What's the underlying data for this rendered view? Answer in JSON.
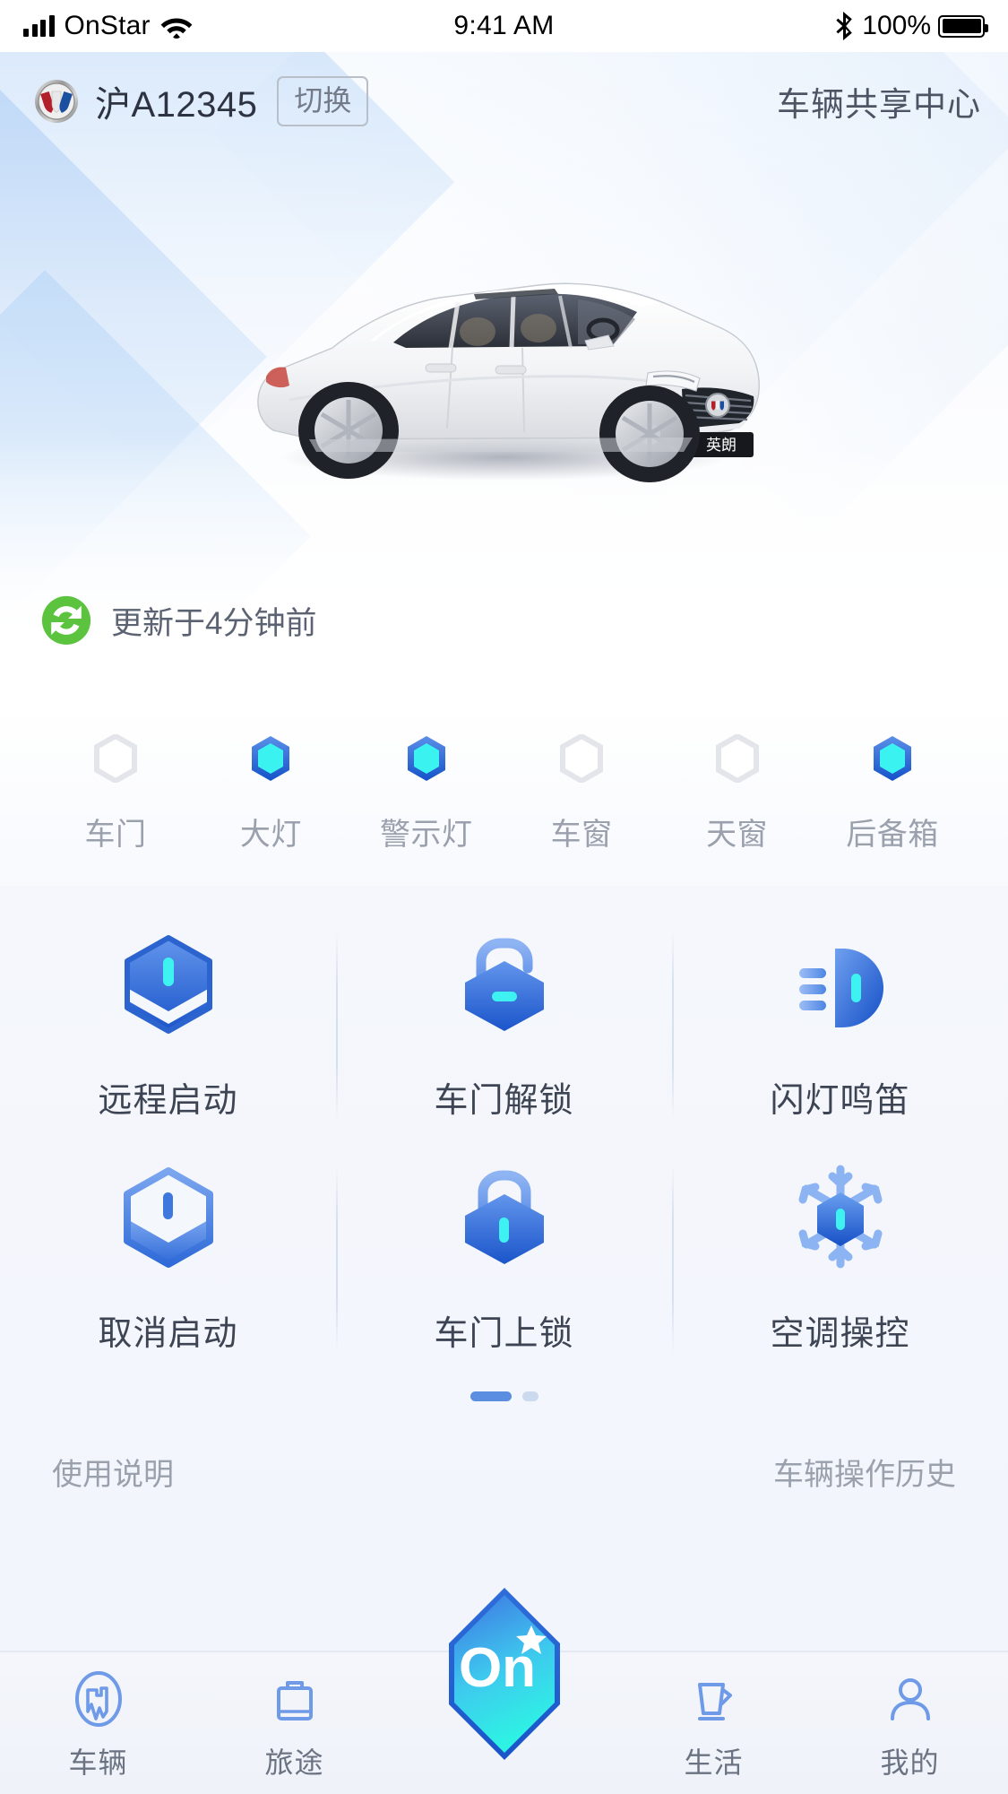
{
  "status_bar": {
    "carrier": "OnStar",
    "time": "9:41 AM",
    "battery_percent": "100%",
    "signal_icon": "signal-bars-icon",
    "wifi_icon": "wifi-icon",
    "bluetooth_icon": "bluetooth-icon",
    "battery_icon": "battery-full-icon"
  },
  "appbar": {
    "logo_icon": "buick-logo-icon",
    "plate": "沪A12345",
    "switch_label": "切换",
    "share_center": "车辆共享中心"
  },
  "hero": {
    "car_icon": "buick-excelle-sedan-image",
    "car_plate_text": "英朗",
    "refresh_icon": "refresh-sync-icon",
    "refresh_text": "更新于4分钟前"
  },
  "vehicle_status": {
    "items": [
      {
        "label": "车门",
        "icon": "hexagon-status-icon",
        "active": false
      },
      {
        "label": "大灯",
        "icon": "hexagon-status-icon",
        "active": true
      },
      {
        "label": "警示灯",
        "icon": "hexagon-status-icon",
        "active": true
      },
      {
        "label": "车窗",
        "icon": "hexagon-status-icon",
        "active": false
      },
      {
        "label": "天窗",
        "icon": "hexagon-status-icon",
        "active": false
      },
      {
        "label": "后备箱",
        "icon": "hexagon-status-icon",
        "active": true
      }
    ]
  },
  "controls": {
    "items": [
      {
        "label": "远程启动",
        "icon": "remote-start-icon"
      },
      {
        "label": "车门解锁",
        "icon": "unlock-icon"
      },
      {
        "label": "闪灯鸣笛",
        "icon": "flash-horn-icon"
      },
      {
        "label": "取消启动",
        "icon": "cancel-start-icon"
      },
      {
        "label": "车门上锁",
        "icon": "lock-icon"
      },
      {
        "label": "空调操控",
        "icon": "air-conditioning-icon"
      }
    ],
    "pager": {
      "total": 2,
      "current": 1
    }
  },
  "footer_links": {
    "left": "使用说明",
    "right": "车辆操作历史"
  },
  "tabbar": {
    "items": [
      {
        "label": "车辆",
        "icon": "vehicle-shield-icon",
        "active": true
      },
      {
        "label": "旅途",
        "icon": "travel-bag-icon",
        "active": false
      },
      {
        "label": "",
        "icon": "onstar-on-badge-icon",
        "active": false,
        "badge_text": "On"
      },
      {
        "label": "生活",
        "icon": "lifestyle-cup-icon",
        "active": false
      },
      {
        "label": "我的",
        "icon": "profile-person-icon",
        "active": false
      }
    ]
  },
  "colors": {
    "accent_blue": "#3f7ae0",
    "accent_cyan": "#40f2f0",
    "refresh_green": "#5cc33f",
    "inactive_gray": "#9aa1ad",
    "panel_bg": "#f3f6fc"
  }
}
